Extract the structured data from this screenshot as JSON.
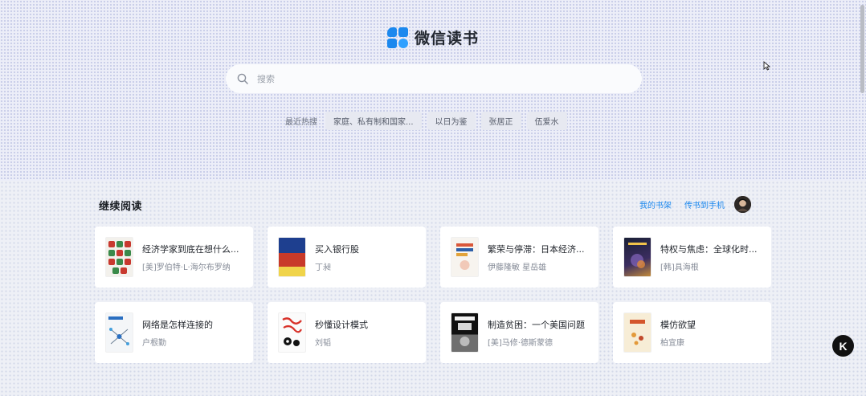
{
  "app": {
    "name": "微信读书"
  },
  "search": {
    "placeholder": "搜索"
  },
  "hot": {
    "label": "最近热搜",
    "tags": [
      "家庭、私有制和国家...",
      "以日为鉴",
      "张居正",
      "伍爱水"
    ]
  },
  "section": {
    "title": "继续阅读",
    "shelf_link": "我的书架",
    "transfer_link": "传书到手机"
  },
  "books": [
    {
      "title": "经济学家到底在想什么...",
      "author": "[美]罗伯特·L·海尔布罗纳"
    },
    {
      "title": "买入银行股",
      "author": "丁昶"
    },
    {
      "title": "繁荣与停滞：日本经济...",
      "author": "伊藤隆敏 星岳雄"
    },
    {
      "title": "特权与焦虑：全球化时...",
      "author": "[韩]具海根"
    },
    {
      "title": "网络是怎样连接的",
      "author": "户根勤"
    },
    {
      "title": "秒懂设计模式",
      "author": "刘韬"
    },
    {
      "title": "制造贫困：一个美国问题",
      "author": "[美]马修·德斯蒙德"
    },
    {
      "title": "模仿欲望",
      "author": "柏宜康"
    }
  ],
  "floating_button": {
    "label": "K"
  },
  "colors": {
    "accent": "#1b88ee",
    "background": "#eef0f6",
    "card": "#ffffff"
  }
}
